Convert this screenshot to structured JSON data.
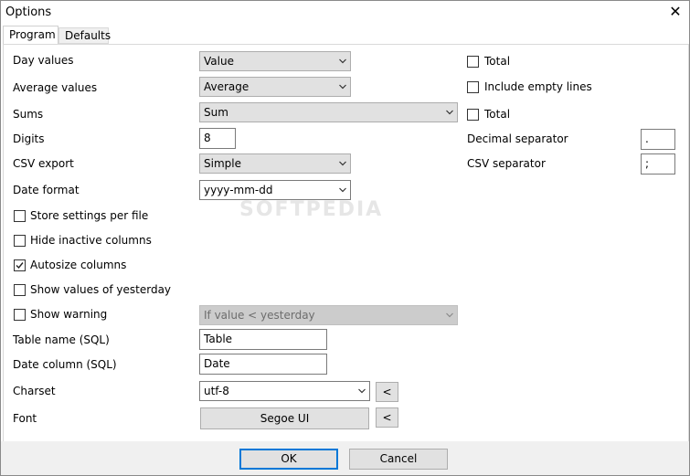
{
  "window": {
    "title": "Options",
    "close_glyph": "✕"
  },
  "tabs": [
    {
      "label": "Program"
    },
    {
      "label": "Defaults"
    }
  ],
  "program": {
    "day_values": {
      "label": "Day values",
      "selected": "Value"
    },
    "average_values": {
      "label": "Average values",
      "selected": "Average"
    },
    "sums": {
      "label": "Sums",
      "selected": "Sum"
    },
    "digits": {
      "label": "Digits",
      "value": "8"
    },
    "csv_export": {
      "label": "CSV export",
      "selected": "Simple"
    },
    "date_format": {
      "label": "Date format",
      "selected": "yyyy-mm-dd"
    },
    "store_settings": {
      "label": "Store settings per file",
      "checked": false
    },
    "hide_inactive": {
      "label": "Hide inactive columns",
      "checked": false
    },
    "autosize": {
      "label": "Autosize columns",
      "checked": true
    },
    "show_yesterday": {
      "label": "Show values of yesterday",
      "checked": false
    },
    "show_warning": {
      "label": "Show warning",
      "checked": false,
      "condition": "If value < yesterday"
    },
    "table_name": {
      "label": "Table name (SQL)",
      "value": "Table"
    },
    "date_column": {
      "label": "Date column (SQL)",
      "value": "Date"
    },
    "charset": {
      "label": "Charset",
      "selected": "utf-8",
      "reset_label": "<"
    },
    "font": {
      "label": "Font",
      "button_label": "Segoe UI",
      "reset_label": "<"
    },
    "total_day": {
      "label": "Total",
      "checked": false
    },
    "include_empty": {
      "label": "Include empty lines",
      "checked": false
    },
    "total_sums": {
      "label": "Total",
      "checked": false
    },
    "decimal_separator": {
      "label": "Decimal separator",
      "value": "."
    },
    "csv_separator": {
      "label": "CSV separator",
      "value": ";"
    }
  },
  "watermark": "SOFTPEDIA",
  "footer": {
    "ok_label": "OK",
    "cancel_label": "Cancel"
  },
  "colors": {
    "accent": "#0078d7",
    "button_face": "#e1e1e1",
    "footer_bg": "#f0f0f0"
  }
}
